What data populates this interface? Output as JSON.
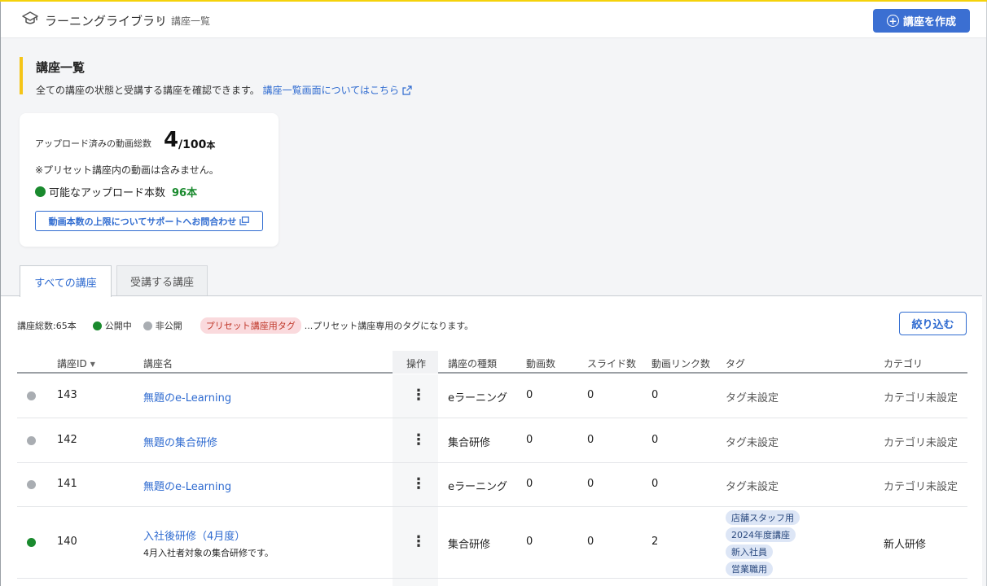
{
  "header": {
    "brand": "ラーニングライブラリ",
    "separator": "›",
    "crumb": "講座一覧",
    "create_button": "講座を作成"
  },
  "page": {
    "title": "講座一覧",
    "description": "全ての講座の状態と受講する講座を確認できます。",
    "help_link": "講座一覧画面についてはこちら"
  },
  "upload": {
    "label": "アップロード済みの動画総数",
    "count": "4",
    "total": "/100",
    "unit": "本",
    "note": "※プリセット講座内の動画は含みません。",
    "available_label": "可能なアップロード本数",
    "available_count": "96本",
    "support_button": "動画本数の上限についてサポートへお問合わせ"
  },
  "tabs": [
    {
      "label": "すべての講座",
      "active": true
    },
    {
      "label": "受講する講座",
      "active": false
    }
  ],
  "summary": {
    "total": "講座総数:65本",
    "public_label": "公開中",
    "private_label": "非公開",
    "preset_tag": "プリセット講座用タグ",
    "preset_desc": "...プリセット講座専用のタグになります。",
    "filter_button": "絞り込む"
  },
  "colors": {
    "public": "#1a8a2e",
    "private": "#a9adb2",
    "accent": "#2f6bd0",
    "highlight": "#f5c518"
  },
  "table": {
    "headers": {
      "id": "講座ID",
      "name": "講座名",
      "ops": "操作",
      "type": "講座の種類",
      "videos": "動画数",
      "slides": "スライド数",
      "links": "動画リンク数",
      "tags": "タグ",
      "category": "カテゴリ"
    },
    "rows": [
      {
        "status": "private",
        "id": "143",
        "name": "無題のe-Learning",
        "desc": "",
        "ops": "⋮",
        "type": "eラーニング",
        "videos": "0",
        "slides": "0",
        "links": "0",
        "tags_text": "タグ未設定",
        "tags": [],
        "category": "カテゴリ未設定"
      },
      {
        "status": "private",
        "id": "142",
        "name": "無題の集合研修",
        "desc": "",
        "ops": "⋮",
        "type": "集合研修",
        "videos": "0",
        "slides": "0",
        "links": "0",
        "tags_text": "タグ未設定",
        "tags": [],
        "category": "カテゴリ未設定"
      },
      {
        "status": "private",
        "id": "141",
        "name": "無題のe-Learning",
        "desc": "",
        "ops": "⋮",
        "type": "eラーニング",
        "videos": "0",
        "slides": "0",
        "links": "0",
        "tags_text": "タグ未設定",
        "tags": [],
        "category": "カテゴリ未設定"
      },
      {
        "status": "public",
        "id": "140",
        "name": "入社後研修（4月度）",
        "desc": "4月入社者対象の集合研修です。",
        "ops": "⋮",
        "type": "集合研修",
        "videos": "0",
        "slides": "0",
        "links": "2",
        "tags_text": "",
        "tags": [
          "店舗スタッフ用",
          "2024年度講座",
          "新入社員",
          "営業職用"
        ],
        "category": "新人研修"
      }
    ]
  }
}
